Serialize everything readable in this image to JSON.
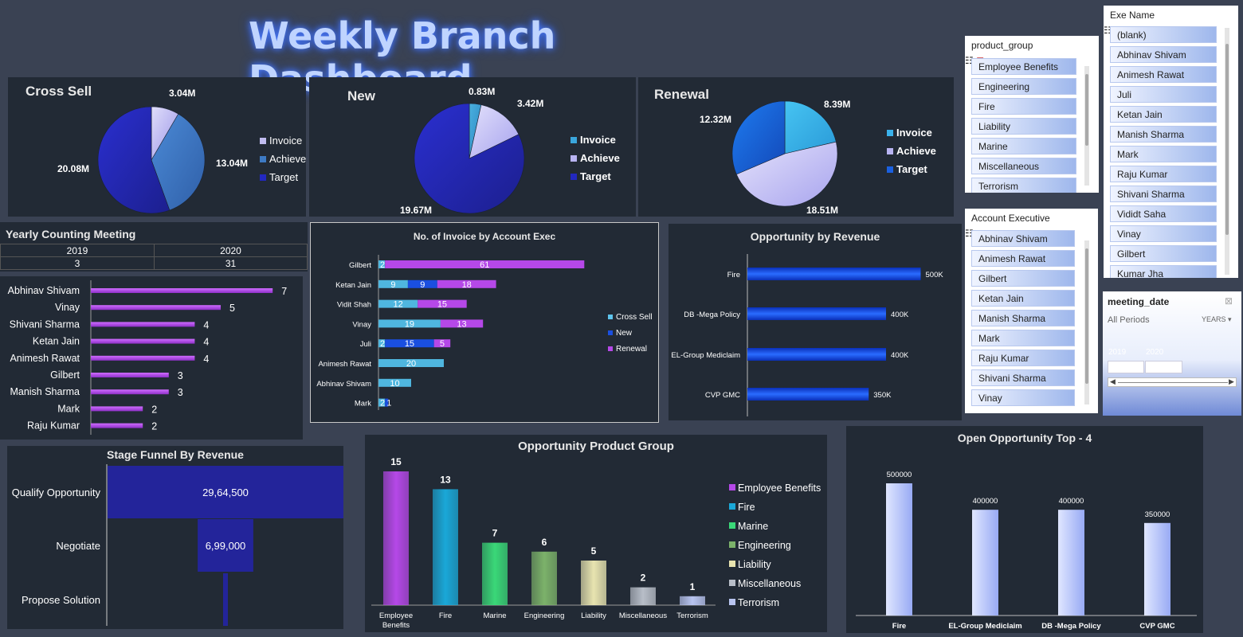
{
  "title": "Weekly Branch Dashboard",
  "cross_sell": {
    "title": "Cross Sell",
    "labels": [
      "3.04M",
      "13.04M",
      "20.08M"
    ],
    "legend": [
      "Invoice",
      "Achieve",
      "Target"
    ]
  },
  "new_chart": {
    "title": "New",
    "labels": [
      "0.83M",
      "3.42M",
      "19.67M"
    ],
    "legend": [
      "Invoice",
      "Achieve",
      "Target"
    ]
  },
  "renewal": {
    "title": "Renewal",
    "labels": [
      "8.39M",
      "18.51M",
      "12.32M"
    ],
    "legend": [
      "Invoice",
      "Achieve",
      "Target"
    ]
  },
  "yearly": {
    "title": "Yearly Counting Meeting",
    "years": [
      "2019",
      "2020"
    ],
    "counts": [
      "3",
      "31"
    ]
  },
  "invoice_exec": {
    "title": "No. of Invoice by Account Exec",
    "legend": [
      "Cross Sell",
      "New",
      "Renewal"
    ]
  },
  "opp_revenue": {
    "title": "Opportunity by Revenue"
  },
  "stage_funnel": {
    "title": "Stage Funnel By Revenue"
  },
  "opp_product": {
    "title": "Opportunity Product Group"
  },
  "open_opp": {
    "title": "Open Opportunity Top - 4"
  },
  "slicer_product": {
    "header": "product_group",
    "items": [
      "Employee Benefits",
      "Engineering",
      "Fire",
      "Liability",
      "Marine",
      "Miscellaneous",
      "Terrorism"
    ]
  },
  "slicer_exe": {
    "header": "Exe Name",
    "items": [
      "(blank)",
      "Abhinav Shivam",
      "Animesh Rawat",
      "Juli",
      "Ketan Jain",
      "Manish Sharma",
      "Mark",
      "Raju Kumar",
      "Shivani Sharma",
      "Vididt Saha",
      "Vinay",
      "Gilbert",
      "Kumar Jha"
    ]
  },
  "slicer_account": {
    "header": "Account Executive",
    "items": [
      "Abhinav Shivam",
      "Animesh Rawat",
      "Gilbert",
      "Ketan Jain",
      "Manish Sharma",
      "Mark",
      "Raju Kumar",
      "Shivani Sharma",
      "Vinay"
    ]
  },
  "timeline": {
    "header": "meeting_date",
    "period": "All Periods",
    "level": "YEARS",
    "years": [
      "2019",
      "2020"
    ]
  },
  "colors": {
    "background": "#3a4253",
    "panel": "#222a35",
    "purple_bar": "#b548e8",
    "blue_bar": "#1a4fe0",
    "funnel": "#23249a"
  },
  "chart_data": [
    {
      "type": "pie",
      "title": "Cross Sell",
      "categories": [
        "Invoice",
        "Achieve",
        "Target"
      ],
      "values": [
        3.04,
        13.04,
        20.08
      ]
    },
    {
      "type": "pie",
      "title": "New",
      "categories": [
        "Invoice",
        "Achieve",
        "Target"
      ],
      "values": [
        0.83,
        3.42,
        19.67
      ]
    },
    {
      "type": "pie",
      "title": "Renewal",
      "categories": [
        "Invoice",
        "Achieve",
        "Target"
      ],
      "values": [
        8.39,
        18.51,
        12.32
      ]
    },
    {
      "type": "bar",
      "title": "",
      "categories": [
        "Abhinav Shivam",
        "Vinay",
        "Shivani Sharma",
        "Ketan Jain",
        "Animesh Rawat",
        "Gilbert",
        "Manish Sharma",
        "Mark",
        "Raju Kumar"
      ],
      "values": [
        7,
        5,
        4,
        4,
        4,
        3,
        3,
        2,
        2
      ]
    },
    {
      "type": "bar",
      "title": "No. of Invoice by Account Exec",
      "categories": [
        "Gilbert",
        "Ketan Jain",
        "Vidit Shah",
        "Vinay",
        "Juli",
        "Animesh Rawat",
        "Abhinav Shivam",
        "Mark"
      ],
      "series": [
        {
          "name": "Cross Sell",
          "values": [
            2,
            9,
            12,
            19,
            2,
            20,
            10,
            2
          ]
        },
        {
          "name": "New",
          "values": [
            0,
            9,
            0,
            0,
            15,
            0,
            0,
            1
          ]
        },
        {
          "name": "Renewal",
          "values": [
            61,
            18,
            15,
            13,
            5,
            0,
            0,
            0
          ]
        }
      ]
    },
    {
      "type": "bar",
      "title": "Opportunity by Revenue",
      "categories": [
        "Fire",
        "DB -Mega Policy",
        "EL-Group Mediclaim",
        "CVP GMC"
      ],
      "values": [
        500,
        400,
        400,
        350
      ],
      "value_labels": [
        "500K",
        "400K",
        "400K",
        "350K"
      ]
    },
    {
      "type": "bar",
      "title": "Stage Funnel By Revenue",
      "categories": [
        "Qualify Opportunity",
        "Negotiate",
        "Propose Solution"
      ],
      "values": [
        2964500,
        699000,
        30000
      ],
      "value_labels": [
        "29,64,500",
        "6,99,000",
        ""
      ]
    },
    {
      "type": "bar",
      "title": "Opportunity Product Group",
      "categories": [
        "Employee Benefits",
        "Fire",
        "Marine",
        "Engineering",
        "Liability",
        "Miscellaneous",
        "Terrorism"
      ],
      "values": [
        15,
        13,
        7,
        6,
        5,
        2,
        1
      ],
      "colors": [
        "#b548e8",
        "#1aa8d8",
        "#3ad878",
        "#7cb26a",
        "#e8e4b0",
        "#b8bec8",
        "#b8c4f0"
      ]
    },
    {
      "type": "bar",
      "title": "Open Opportunity Top - 4",
      "categories": [
        "Fire",
        "EL-Group Mediclaim",
        "DB -Mega Policy",
        "CVP GMC"
      ],
      "values": [
        500000,
        400000,
        400000,
        350000
      ]
    }
  ]
}
